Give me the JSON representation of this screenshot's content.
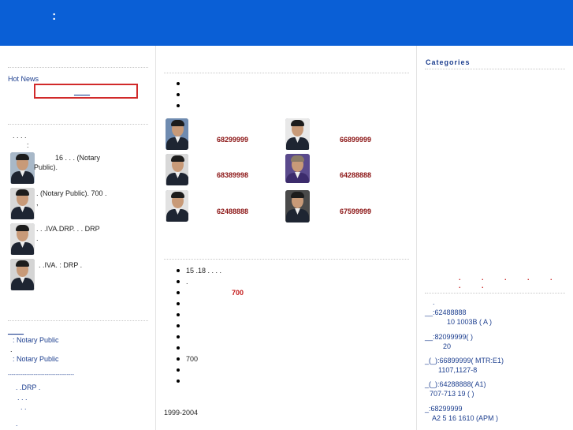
{
  "header": {
    "title": ":"
  },
  "left": {
    "hot_news_label": "Hot News",
    "hot_news_link": "____",
    "dots_line": ". . . .",
    "colon_line": ":",
    "bio1_line1": "16 .      .      .    (Notary",
    "bio1_line2": "Public).",
    "bio2_line1": ".               (Notary Public).    700  .",
    "bio2_line2": ",",
    "bio3_line1": ".   .  .IVA.DRP.  .   .          DRP",
    "bio3_line2": ".",
    "bio4_line1": ".  .IVA.    :       DRP    .",
    "underline_link": "____",
    "np_line1": ":    Notary Public",
    "np_line2": ".",
    "np_line3": ":    Notary Public",
    "dashes": "------------------------------------",
    "drp_line": ".  .DRP  .",
    "dots2": ". . .",
    "dots3": ". .",
    "dot4": "."
  },
  "middle": {
    "top_bullets": [
      "",
      "",
      ""
    ],
    "contacts": [
      {
        "phone": "68299999"
      },
      {
        "phone": "66899999"
      },
      {
        "phone": "68389998"
      },
      {
        "phone": "64288888"
      },
      {
        "phone": "62488888"
      },
      {
        "phone": "67599999"
      }
    ],
    "list": [
      "15   .18   .    .    .    .",
      ".",
      "700",
      "",
      "",
      "",
      "",
      "",
      "700",
      "",
      ""
    ],
    "footer": "1999-2004"
  },
  "right": {
    "categories_title": "Categories",
    "red_dots": ". . . . . . .",
    "dot_line": ".",
    "offices": [
      {
        "line1": "__:62488888",
        "line2": "10 1003B  (   A )"
      },
      {
        "line1": "__:82099999(    )",
        "line2": "20"
      },
      {
        "line1": "_(_):66899999(    MTR:E1)",
        "line2": "1107,1127-8"
      },
      {
        "line1": "_(_):64288888(    A1)",
        "line2": "707-713     19 (     )"
      },
      {
        "line1": "_:68299999",
        "line2": "A2    5      16 1610 (APM  )"
      }
    ]
  }
}
